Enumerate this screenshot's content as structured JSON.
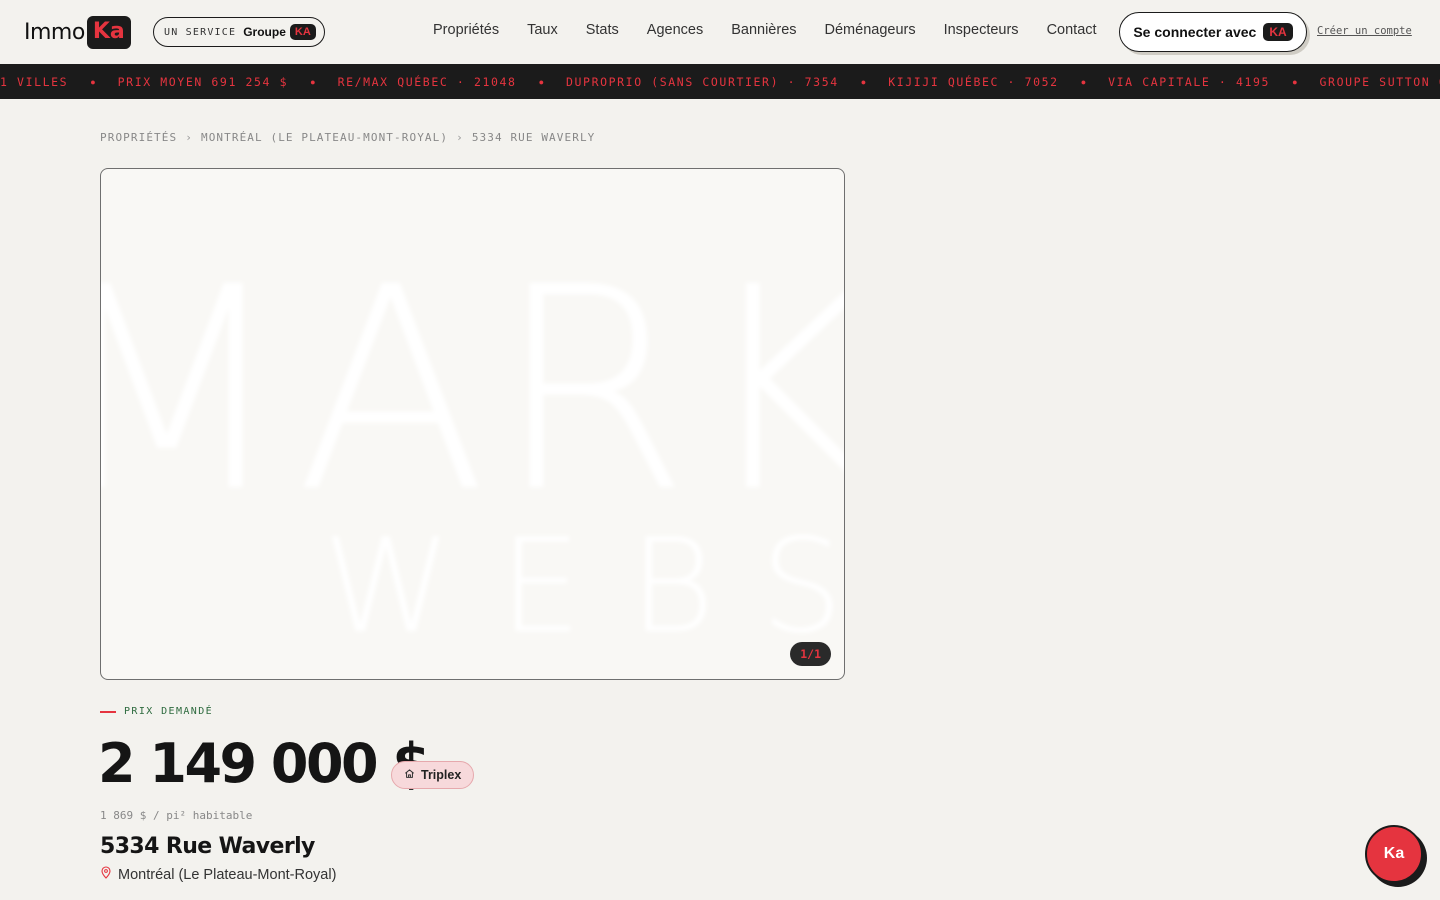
{
  "header": {
    "logo_text": "Immo",
    "logo_badge": "Ka",
    "service_label": "UN SERVICE",
    "service_groupe": "Groupe",
    "service_badge": "KA",
    "nav": [
      "Propriétés",
      "Taux",
      "Stats",
      "Agences",
      "Bannières",
      "Déménageurs",
      "Inspecteurs",
      "Contact"
    ],
    "login_label": "Se connecter avec",
    "login_badge": "KA",
    "create_account": "Créer un compte"
  },
  "ticker": {
    "items": [
      "1 VILLES",
      "PRIX MOYEN 691 254 $",
      "RE/MAX QUÉBEC · 21048",
      "DUPROPRIO (SANS COURTIER) · 7354",
      "KIJIJI QUÉBEC · 7052",
      "VIA CAPITALE · 4195",
      "GROUPE SUTTON QUÉBEC"
    ]
  },
  "breadcrumb": [
    "PROPRIÉTÉS",
    "MONTRÉAL (LE PLATEAU-MONT-ROYAL)",
    "5334 RUE WAVERLY"
  ],
  "breadcrumb_separator": "›",
  "gallery": {
    "watermark_line1": "MARKE",
    "watermark_line2": "WEBS",
    "counter": "1/1"
  },
  "listing": {
    "price_label": "PRIX DEMANDÉ",
    "price": "2 149 000 $",
    "type": "Triplex",
    "price_per_sqft": "1 869 $ / pi² habitable",
    "address": "5334 Rue Waverly",
    "location": "Montréal (Le Plateau-Mont-Royal)"
  },
  "fab_label": "Ka",
  "colors": {
    "accent": "#e5343f",
    "dark": "#1b1b1b",
    "background": "#f3f2ee",
    "label_green": "#2d6a3e"
  },
  "icons": {
    "type_icon": "house-icon",
    "location_icon": "map-pin-icon"
  }
}
